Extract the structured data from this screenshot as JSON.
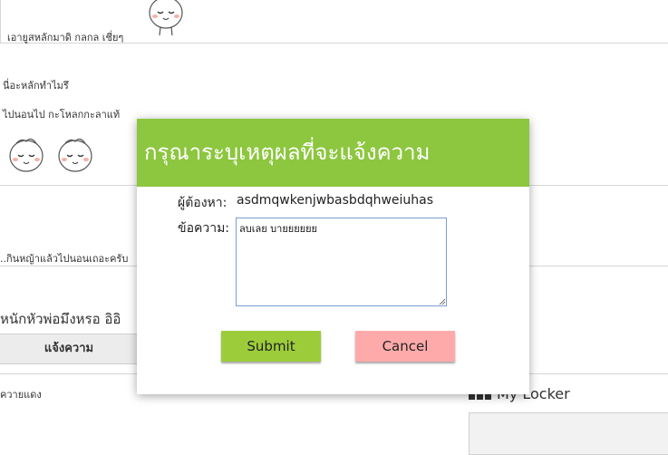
{
  "background": {
    "post1_text": "เอายูสหลักมาดิ กลกล เชี่ยๆ",
    "post2_line1": "นี่อะหลักทำไมรึ",
    "post2_line2": "ไปนอนไป กะโหลกกะลาแท้",
    "post3_text": "..กินหญ้าแล้วไปนอนเถอะครับ",
    "section_title": "หนักหัวพ่อมึงหรอ อิอิ",
    "report_column_header": "แจ้งความ",
    "row_text": "ควายแดง",
    "locker_title": "My Locker"
  },
  "modal": {
    "title": "กรุณาระบุเหตุผลที่จะแจ้งความ",
    "accused_label": "ผู้ต้องหา:",
    "accused_value": "asdmqwkenjwbasbdqhweiuhas",
    "message_label": "ข้อความ:",
    "message_value": "ลบเลย บายยยยยย",
    "submit_label": "Submit",
    "cancel_label": "Cancel"
  },
  "colors": {
    "header_green": "#8dc63f",
    "submit_green": "#9ccc3a",
    "cancel_pink": "#ffaaaa"
  },
  "icons": {
    "emoticon": "smiling-face-emoticon"
  }
}
